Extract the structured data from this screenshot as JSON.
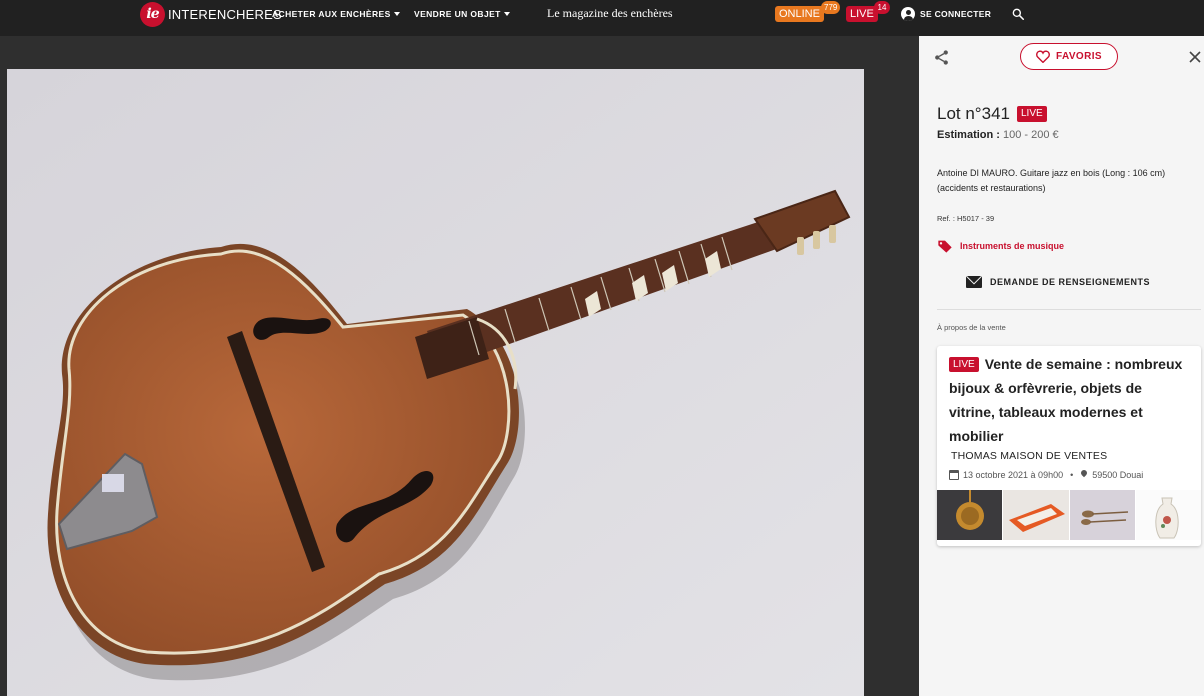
{
  "header": {
    "brand_mark": "ie",
    "brand_name": "INTERENCHERES",
    "nav": {
      "buy_label": "ACHETER AUX ENCHÈRES",
      "sell_label": "VENDRE UN OBJET"
    },
    "magazine_label": "Le magazine des enchères",
    "online_label": "ONLINE",
    "online_count": "779",
    "live_label": "LIVE",
    "live_count": "14",
    "login_label": "SE CONNECTER",
    "icons": {
      "user": "user-icon",
      "search": "search-icon"
    }
  },
  "photo": {
    "subject": "guitar-image"
  },
  "panel": {
    "favorites_label": "FAVORIS",
    "lot_title": "Lot n°341",
    "live_badge": "LIVE",
    "estimate_label": "Estimation :",
    "estimate_value": "100 - 200 €",
    "description": "Antoine DI MAURO. Guitare jazz en bois (Long : 106 cm) (accidents et restaurations)",
    "ref": "Ref. : H5017 - 39",
    "category": "Instruments de musique",
    "info_request_label": "DEMANDE DE RENSEIGNEMENTS",
    "about_sale_label": "À propos de la vente",
    "sale": {
      "live_badge": "LIVE",
      "title": "Vente de semaine : nombreux bijoux & orfèvrerie, objets de vitrine, tableaux modernes et mobilier",
      "auctioneer": "THOMAS MAISON DE VENTES",
      "date": "13 octobre 2021 à 09h00",
      "separator": "•",
      "location": "59500 Douai"
    },
    "icons": {
      "share": "share-icon",
      "heart": "heart-icon",
      "close": "close-icon",
      "tag": "tag-icon",
      "mail": "mail-icon"
    },
    "colors": {
      "accent": "#c8102e",
      "online": "#e8781f"
    }
  }
}
